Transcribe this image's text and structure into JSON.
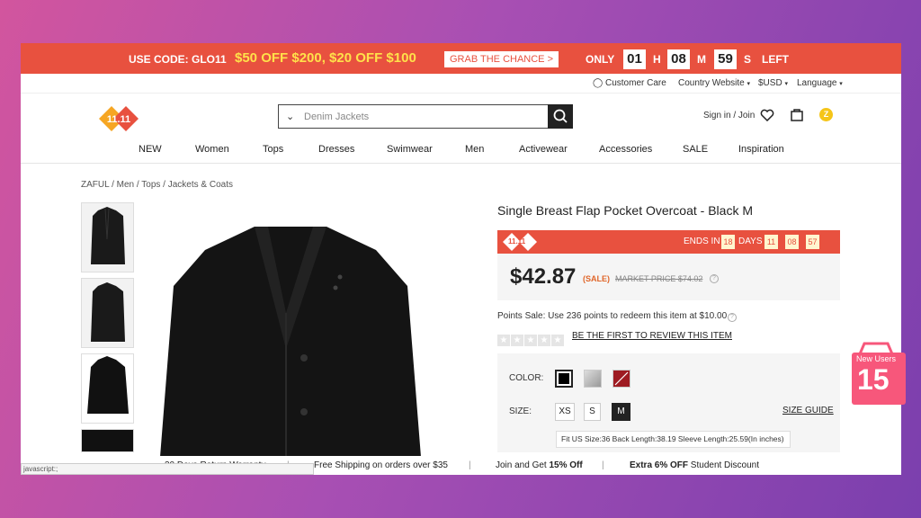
{
  "promo": {
    "code_label": "USE CODE: GLO11",
    "deal": "$50 OFF $200, $20 OFF $100",
    "grab_label": "GRAB THE CHANCE >",
    "only": "ONLY",
    "hours": "01",
    "h": "H",
    "minutes": "08",
    "m": "M",
    "seconds": "59",
    "s": "S",
    "left": "LEFT"
  },
  "utility": {
    "customer_care": "Customer Care",
    "country": "Country Website",
    "currency": "$USD",
    "language": "Language"
  },
  "header": {
    "logo_text": "11.11",
    "search_placeholder": "Denim Jackets",
    "sign_in": "Sign in / Join",
    "coin": "Z"
  },
  "nav": [
    "NEW",
    "Women",
    "Tops",
    "Dresses",
    "Swimwear",
    "Men",
    "Activewear",
    "Accessories",
    "SALE",
    "Inspiration"
  ],
  "breadcrumb": {
    "a": "ZAFUL",
    "b": "Men",
    "c": "Tops",
    "d": "Jackets & Coats",
    "sep": " / "
  },
  "product": {
    "title": "Single Breast Flap Pocket Overcoat - Black M",
    "flash_logo": "11.11",
    "ends_in": "ENDS IN",
    "days_num": "18",
    "days": "DAYS",
    "t_h": "11",
    "t_m": "08",
    "t_s": "57",
    "price": "$42.87",
    "sale": "(SALE)",
    "market_price": "MARKET PRICE $74.02",
    "points_text": "Points Sale: Use 236 points to redeem this item at $10.00",
    "review_link": "BE THE FIRST TO REVIEW THIS ITEM",
    "rating": 0,
    "color_label": "COLOR:",
    "size_label": "SIZE:",
    "sizes": [
      "XS",
      "S",
      "M"
    ],
    "selected_size": "M",
    "size_guide": "SIZE GUIDE",
    "fit_text": "Fit US Size:36   Back Length:38.19   Sleeve Length:25.59(In inches)"
  },
  "footer": {
    "return": "30 Days Return Warranty",
    "shipping": "Free Shipping on orders over $35",
    "join_prefix": "Join and Get ",
    "join_bold": "15% Off",
    "extra_bold": "Extra 6% OFF",
    "extra_rest": " Student Discount",
    "sep": "|"
  },
  "status_bar": "javascript:;",
  "badge": {
    "label": "New Users",
    "num": "15"
  },
  "colors": {
    "accent": "#e8513f",
    "promo_yellow": "#ffe14a",
    "badge_pink": "#f7577b"
  }
}
